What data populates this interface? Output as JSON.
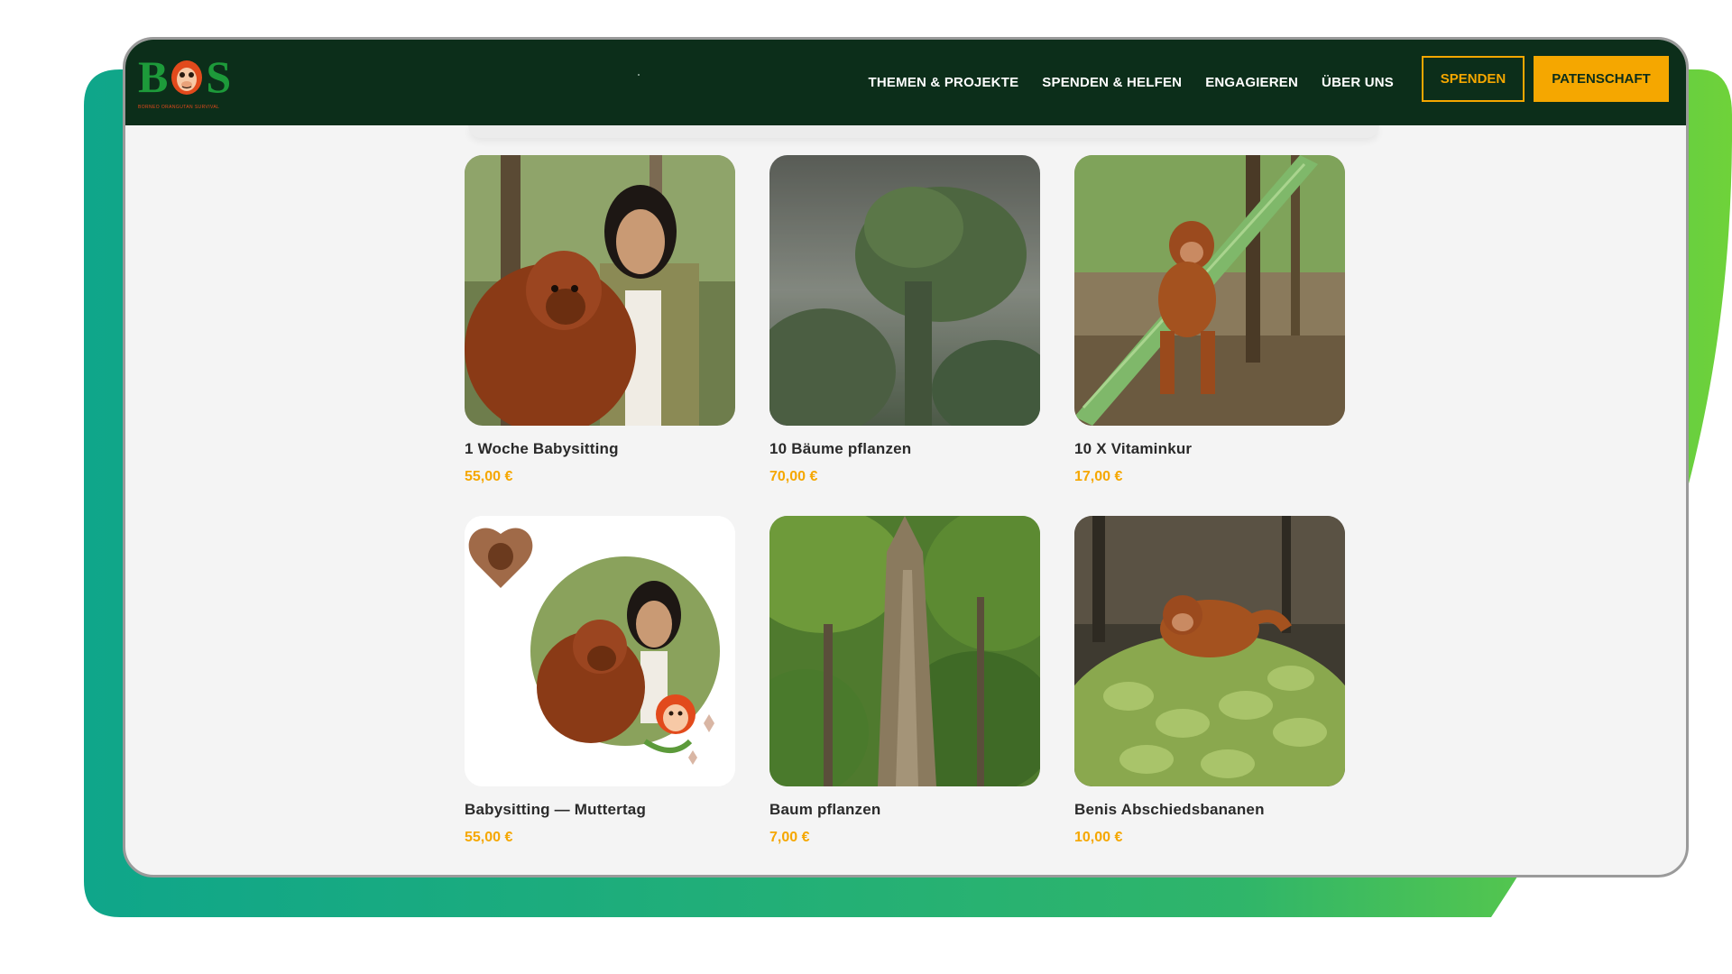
{
  "brand": {
    "logo_letters": [
      "B",
      "S"
    ],
    "tagline": "BORNEO ORANGUTAN SURVIVAL"
  },
  "nav": {
    "items": [
      {
        "label": "THEMEN & PROJEKTE"
      },
      {
        "label": "SPENDEN & HELFEN"
      },
      {
        "label": "ENGAGIEREN"
      },
      {
        "label": "ÜBER UNS"
      }
    ],
    "spenden_label": "SPENDEN",
    "patenschaft_label": "PATENSCHAFT"
  },
  "products": [
    {
      "title": "1 Woche Babysitting",
      "price": "55,00 €",
      "image": "keeper-with-orangutan-photo"
    },
    {
      "title": "10 Bäume pflanzen",
      "price": "70,00 €",
      "image": "misty-rainforest-photo"
    },
    {
      "title": "10 X Vitaminkur",
      "price": "17,00 €",
      "image": "young-orangutan-on-leaf-photo"
    },
    {
      "title": "Babysitting — Muttertag",
      "price": "55,00 €",
      "image": "mothers-day-card-photo"
    },
    {
      "title": "Baum pflanzen",
      "price": "7,00 €",
      "image": "rainforest-tree-photo"
    },
    {
      "title": "Benis Abschiedsbananen",
      "price": "10,00 €",
      "image": "orangutan-on-bananas-photo"
    }
  ],
  "colors": {
    "header_bg": "#0c2e1a",
    "accent": "#f5a700",
    "backdrop_start": "#0fa68a",
    "backdrop_end": "#5ccb3a"
  }
}
